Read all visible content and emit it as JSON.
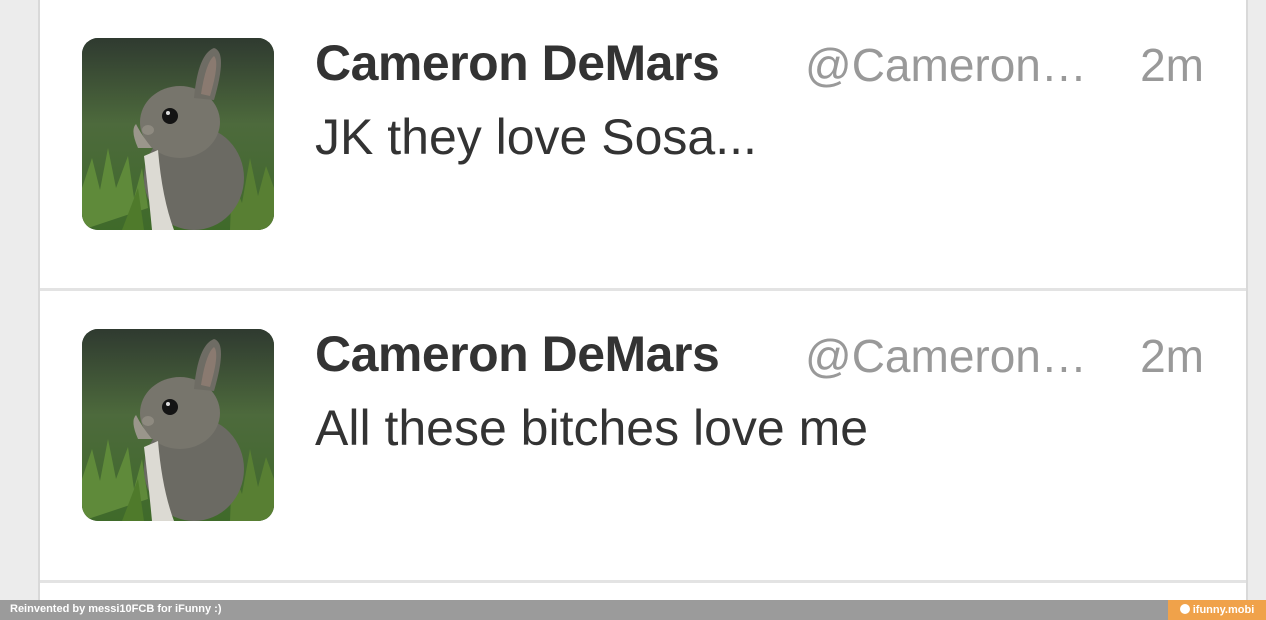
{
  "tweets": [
    {
      "name": "Cameron DeMars",
      "handle": "@Cameron…",
      "time": "2m",
      "text": "JK they love Sosa..."
    },
    {
      "name": "Cameron DeMars",
      "handle": "@Cameron…",
      "time": "2m",
      "text": "All these bitches love me"
    }
  ],
  "footer": {
    "credit": "Reinvented by messi10FCB for iFunny :)",
    "brand": "ifunny.mobi"
  },
  "colors": {
    "background": "#ececec",
    "card": "#ffffff",
    "name": "#333333",
    "meta": "#999999",
    "footer_bar": "#9b9b9b",
    "brand_badge": "#f0a24a"
  },
  "icons": [
    "bunny-avatar-icon",
    "smile-icon"
  ]
}
